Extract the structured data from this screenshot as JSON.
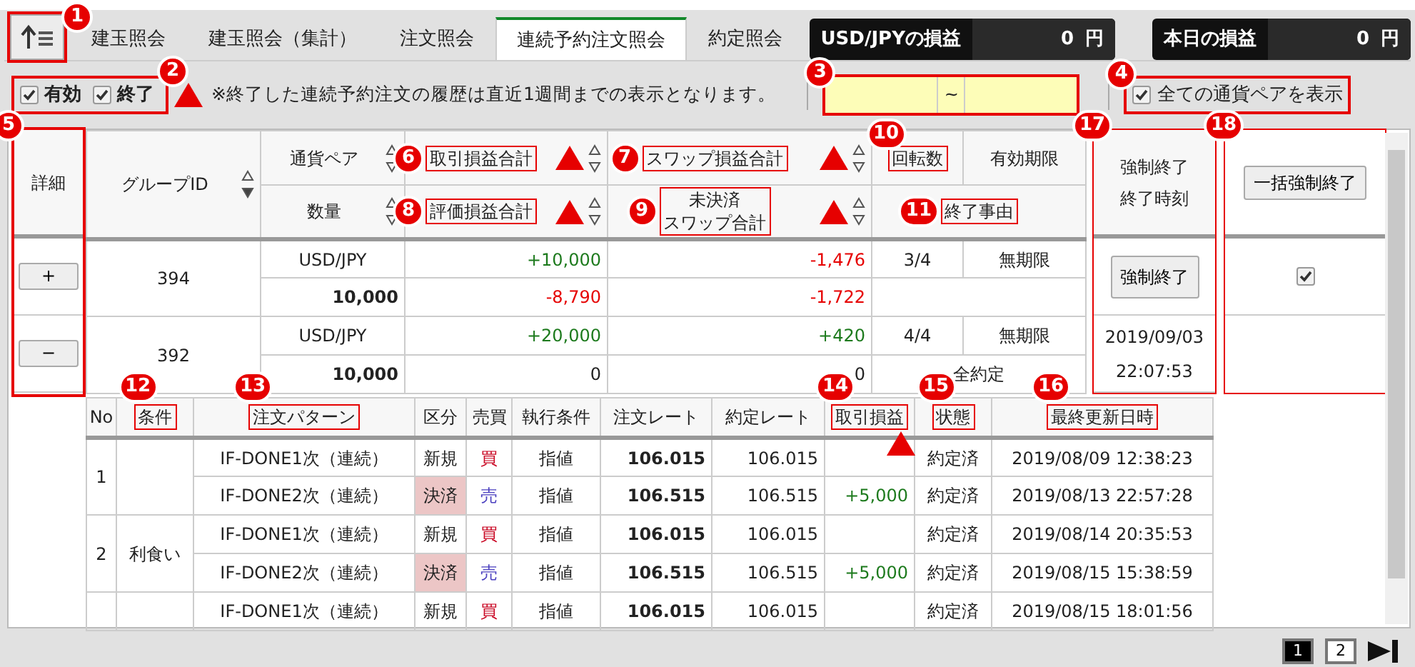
{
  "toggle": {
    "marker": "1"
  },
  "tabs": [
    {
      "label": "建玉照会",
      "selected": false
    },
    {
      "label": "建玉照会（集計）",
      "selected": false
    },
    {
      "label": "注文照会",
      "selected": false
    },
    {
      "label": "連続予約注文照会",
      "selected": true
    },
    {
      "label": "約定照会",
      "selected": false
    }
  ],
  "pnl": [
    {
      "label": "USD/JPYの損益",
      "value": "0",
      "unit": "円"
    },
    {
      "label": "本日の損益",
      "value": "0",
      "unit": "円"
    }
  ],
  "filters": {
    "marker": "2",
    "status_checks": [
      {
        "label": "有効",
        "checked": true
      },
      {
        "label": "終了",
        "checked": true
      }
    ],
    "triangle": true,
    "note": "※終了した連続予約注文の履歴は直近1週間までの表示となります。",
    "date_range": {
      "marker": "3",
      "separator": "~"
    },
    "all_pairs": {
      "marker": "4",
      "label": "全ての通貨ペアを表示",
      "checked": true
    }
  },
  "summary": {
    "detail": {
      "label": "詳細",
      "marker": "5"
    },
    "header": {
      "group_id": {
        "label": "グループID",
        "sorted": true
      },
      "pair": {
        "label": "通貨ペア",
        "sorted": false
      },
      "qty": {
        "label": "数量",
        "sorted": false
      },
      "trade_pl": {
        "label": "取引損益合計",
        "marker": "6",
        "triangle": true,
        "sorted": false
      },
      "swap_pl": {
        "label": "スワップ損益合計",
        "marker": "7",
        "triangle": true,
        "sorted": false
      },
      "eval_pl": {
        "label": "評価損益合計",
        "marker": "8",
        "triangle": true,
        "sorted": false
      },
      "open_swap": {
        "lines": [
          "未決済",
          "スワップ合計"
        ],
        "marker": "9",
        "triangle": true,
        "sorted": false
      },
      "turns": {
        "label": "回転数",
        "marker": "10"
      },
      "expiry": {
        "label": "有効期限"
      },
      "end_reason": {
        "label": "終了事由",
        "marker": "11"
      }
    },
    "groups": [
      {
        "detail_button": "+",
        "group_id": "394",
        "pair": "USD/JPY",
        "qty": "10,000",
        "trade_pl": {
          "text": "+10,000",
          "color": "#1d7a1d"
        },
        "eval_pl": {
          "text": "-8,790",
          "color": "#e60000"
        },
        "swap_pl": {
          "text": "-1,476",
          "color": "#e60000"
        },
        "open_swap": {
          "text": "-1,722",
          "color": "#e60000"
        },
        "turns": "3/4",
        "expiry": "無期限"
      },
      {
        "detail_button": "−",
        "group_id": "392",
        "pair": "USD/JPY",
        "qty": "10,000",
        "trade_pl": {
          "text": "+20,000",
          "color": "#1d7a1d"
        },
        "eval_pl": {
          "text": "0",
          "color": "#222222"
        },
        "swap_pl": {
          "text": "+420",
          "color": "#1d7a1d"
        },
        "open_swap": {
          "text": "0",
          "color": "#222222"
        },
        "turns": "4/4",
        "expiry": "無期限",
        "end_reason": "全約定"
      }
    ]
  },
  "force_end": {
    "header": "強制終了終了時刻",
    "marker": "17",
    "cells": [
      {
        "kind": "button",
        "label": "強制終了"
      },
      {
        "kind": "text",
        "text": "2019/09/03 22:07:53"
      }
    ]
  },
  "bulk": {
    "header_button": "一括強制終了",
    "marker": "18",
    "cells": [
      {
        "kind": "checkbox",
        "checked": true
      }
    ]
  },
  "orders": {
    "columns": [
      {
        "label": "No"
      },
      {
        "label": "条件",
        "marker": "12"
      },
      {
        "label": "注文パターン",
        "marker": "13"
      },
      {
        "label": "区分"
      },
      {
        "label": "売買"
      },
      {
        "label": "執行条件"
      },
      {
        "label": "注文レート"
      },
      {
        "label": "約定レート"
      },
      {
        "label": "取引損益",
        "marker": "14",
        "triangle": true
      },
      {
        "label": "状態",
        "marker": "15"
      },
      {
        "label": "最終更新日時",
        "marker": "16"
      }
    ],
    "groups": [
      {
        "no": "1",
        "rows": [
          {
            "pattern": "IF-DONE1次（連続）",
            "category": {
              "text": "新規",
              "kind": "new"
            },
            "side": {
              "text": "買",
              "kind": "buy"
            },
            "exec": "指値",
            "order_rate": "106.015",
            "fill_rate": "106.015",
            "status": "約定済",
            "updated": "2019/08/09 12:38:23"
          },
          {
            "pattern": "IF-DONE2次（連続）",
            "category": {
              "text": "決済",
              "kind": "close"
            },
            "side": {
              "text": "売",
              "kind": "sell"
            },
            "exec": "指値",
            "order_rate": "106.515",
            "fill_rate": "106.515",
            "pl": {
              "text": "+5,000",
              "color": "#1d7a1d"
            },
            "status": "約定済",
            "updated": "2019/08/13 22:57:28"
          }
        ]
      },
      {
        "no": "2",
        "condition": "利食い",
        "rows": [
          {
            "pattern": "IF-DONE1次（連続）",
            "category": {
              "text": "新規",
              "kind": "new"
            },
            "side": {
              "text": "買",
              "kind": "buy"
            },
            "exec": "指値",
            "order_rate": "106.015",
            "fill_rate": "106.015",
            "status": "約定済",
            "updated": "2019/08/14 20:35:53"
          },
          {
            "pattern": "IF-DONE2次（連続）",
            "category": {
              "text": "決済",
              "kind": "close"
            },
            "side": {
              "text": "売",
              "kind": "sell"
            },
            "exec": "指値",
            "order_rate": "106.515",
            "fill_rate": "106.515",
            "pl": {
              "text": "+5,000",
              "color": "#1d7a1d"
            },
            "status": "約定済",
            "updated": "2019/08/15 15:38:59"
          }
        ]
      },
      {
        "rows": [
          {
            "pattern": "IF-DONE1次（連続）",
            "category": {
              "text": "新規",
              "kind": "new"
            },
            "side": {
              "text": "買",
              "kind": "buy"
            },
            "exec": "指値",
            "order_rate": "106.015",
            "fill_rate": "106.015",
            "status": "約定済",
            "updated": "2019/08/15 18:01:56"
          }
        ]
      }
    ]
  },
  "pagination": {
    "pages": [
      {
        "label": "1",
        "selected": true
      },
      {
        "label": "2",
        "selected": false
      }
    ]
  }
}
